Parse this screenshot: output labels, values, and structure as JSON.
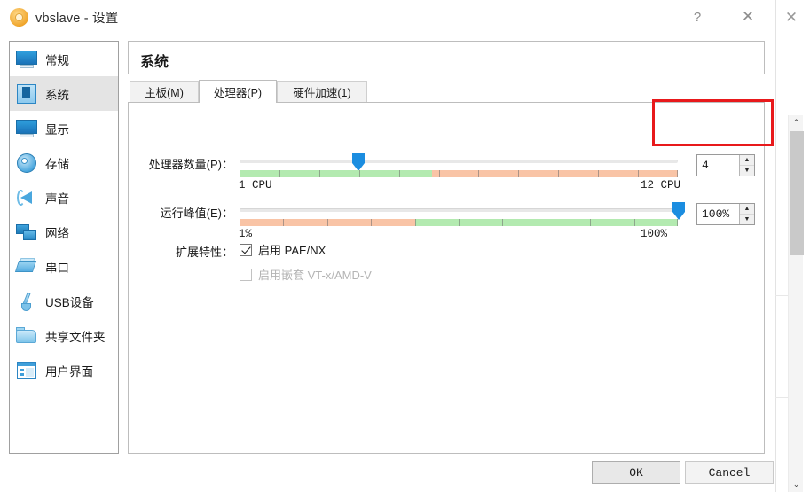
{
  "window": {
    "title": "vbslave - 设置",
    "icon": "gear-icon",
    "help_label": "?",
    "close_label": "✕",
    "background_close_label": "✕"
  },
  "sidebar": {
    "items": [
      {
        "label": "常规",
        "icon": "monitor-icon",
        "selected": false
      },
      {
        "label": "系统",
        "icon": "cpu-chip-icon",
        "selected": true
      },
      {
        "label": "显示",
        "icon": "display-icon",
        "selected": false
      },
      {
        "label": "存储",
        "icon": "harddisk-icon",
        "selected": false
      },
      {
        "label": "声音",
        "icon": "speaker-icon",
        "selected": false
      },
      {
        "label": "网络",
        "icon": "network-icon",
        "selected": false
      },
      {
        "label": "串口",
        "icon": "serial-port-icon",
        "selected": false
      },
      {
        "label": "USB设备",
        "icon": "usb-icon",
        "selected": false
      },
      {
        "label": "共享文件夹",
        "icon": "folder-icon",
        "selected": false
      },
      {
        "label": "用户界面",
        "icon": "user-interface-icon",
        "selected": false
      }
    ]
  },
  "panel": {
    "header": "系统",
    "tabs": [
      {
        "label": "主板(M)",
        "active": false
      },
      {
        "label": "处理器(P)",
        "active": true
      },
      {
        "label": "硬件加速(1)",
        "active": false
      }
    ]
  },
  "processor": {
    "count_label": "处理器数量(P)：",
    "count_value": "4",
    "count_min_label": "1 CPU",
    "count_max_label": "12 CPU",
    "count_min": 1,
    "count_max": 12,
    "count_handle_percent": 27,
    "count_green_percent": 44,
    "count_ticks": 11,
    "cap_label": "运行峰值(E)：",
    "cap_value": "100%",
    "cap_min_label": "1%",
    "cap_max_label": "100%",
    "cap_handle_percent": 99,
    "cap_orange_percent": 40,
    "cap_ticks": 10,
    "color_green": "#b3eab0",
    "color_orange": "#f9c4a6",
    "color_handle": "#1b8de0",
    "spin_up": "▲",
    "spin_down": "▼"
  },
  "extended": {
    "label": "扩展特性：",
    "options": [
      {
        "label": "启用 PAE/NX",
        "checked": true,
        "disabled": false
      },
      {
        "label": "启用嵌套 VT-x/AMD-V",
        "checked": false,
        "disabled": true
      }
    ]
  },
  "footer": {
    "ok_label": "OK",
    "cancel_label": "Cancel"
  },
  "annotation": {
    "color": "#e8191b",
    "target": "processor-count-spinbox"
  },
  "background_window": {
    "scroll_up": "⌃",
    "scroll_down": "⌄"
  }
}
